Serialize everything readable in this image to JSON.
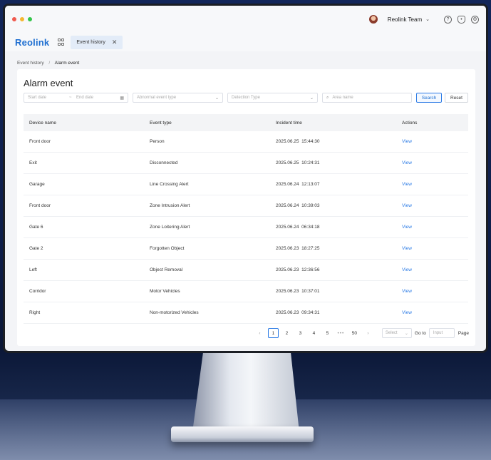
{
  "window": {
    "dots": [
      "#f05a4f",
      "#f5b731",
      "#34c64a"
    ],
    "user_name": "Reolink Team"
  },
  "brand": {
    "logo_text": "Reolink",
    "tab_label": "Event history"
  },
  "breadcrumb": {
    "parent": "Event history",
    "separator": "/",
    "current": "Alarm event"
  },
  "page_title": "Alarm event",
  "filters": {
    "start_date": "Start date",
    "range_sep": "~",
    "end_date": "End date",
    "event_type": "Abnormal event type",
    "detection_type": "Detection Type",
    "area_name": "Area name",
    "search_label": "Search",
    "reset_label": "Reset"
  },
  "table": {
    "headers": [
      "Device name",
      "Event type",
      "Incident time",
      "Actions"
    ],
    "rows": [
      {
        "device": "Front door",
        "event": "Person",
        "date": "2025.06.25",
        "time": "15:44:30",
        "action": "View"
      },
      {
        "device": "Exit",
        "event": "Disconnected",
        "date": "2025.06.25",
        "time": "10:24:31",
        "action": "View"
      },
      {
        "device": "Garage",
        "event": "Line Crossing Alert",
        "date": "2025.06.24",
        "time": "12:13:07",
        "action": "View"
      },
      {
        "device": "Front door",
        "event": "Zone Intrusion Alert",
        "date": "2025.06.24",
        "time": "10:39:03",
        "action": "View"
      },
      {
        "device": "Gate 6",
        "event": "Zone Loitering Alert",
        "date": "2025.06.24",
        "time": "06:34:18",
        "action": "View"
      },
      {
        "device": "Gate 2",
        "event": "Forgotten Object",
        "date": "2025.06.23",
        "time": "18:27:25",
        "action": "View"
      },
      {
        "device": "Left",
        "event": "Object Removal",
        "date": "2025.06.23",
        "time": "12:36:56",
        "action": "View"
      },
      {
        "device": "Corridor",
        "event": "Motor Vehicles",
        "date": "2025.06.23",
        "time": "10:37:01",
        "action": "View"
      },
      {
        "device": "Right",
        "event": "Non-motorized Vehicles",
        "date": "2025.06.23",
        "time": "09:34:31",
        "action": "View"
      }
    ]
  },
  "pagination": {
    "pages": [
      "1",
      "2",
      "3",
      "4",
      "5"
    ],
    "dots": "•••",
    "last": "50",
    "select_placeholder": "Select",
    "goto_label": "Go to",
    "input_placeholder": "Input",
    "page_label": "Page"
  },
  "colors": {
    "accent": "#2c7be5",
    "logo": "#1f6fd1"
  }
}
